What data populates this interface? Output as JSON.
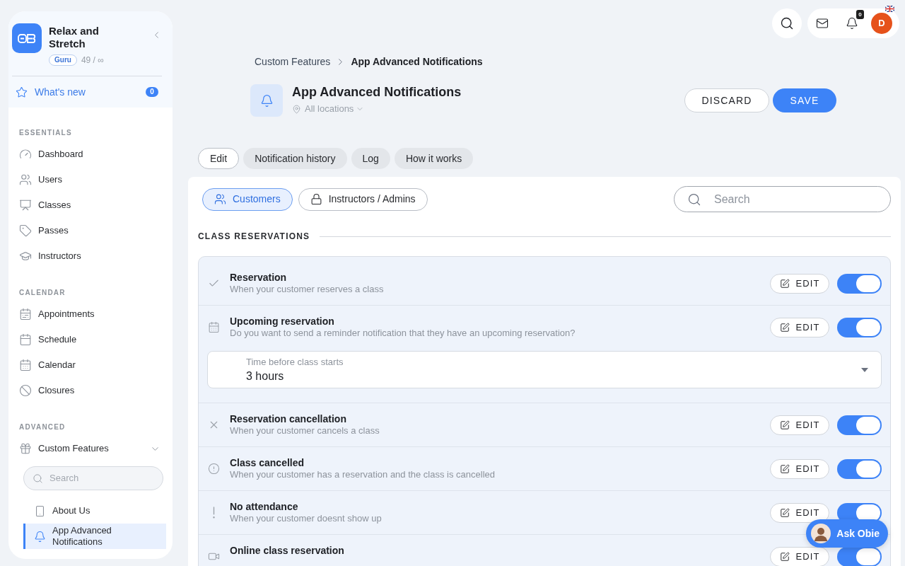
{
  "sidebar": {
    "brand": {
      "name": "Relax and Stretch",
      "plan": "Guru",
      "usage": "49 / ∞"
    },
    "whats_new": {
      "label": "What's new",
      "count": "0"
    },
    "sections": [
      {
        "title": "ESSENTIALS",
        "items": [
          {
            "label": "Dashboard",
            "selected": false
          },
          {
            "label": "Users",
            "selected": false
          },
          {
            "label": "Classes",
            "selected": false
          },
          {
            "label": "Passes",
            "selected": false
          },
          {
            "label": "Instructors",
            "selected": false
          }
        ]
      },
      {
        "title": "CALENDAR",
        "items": [
          {
            "label": "Appointments",
            "selected": false
          },
          {
            "label": "Schedule",
            "selected": false
          },
          {
            "label": "Calendar",
            "selected": false
          },
          {
            "label": "Closures",
            "selected": false
          }
        ]
      },
      {
        "title": "ADVANCED",
        "items": [
          {
            "label": "Custom Features",
            "selected": false,
            "expanded": true,
            "search": {
              "placeholder": "Search"
            },
            "children": [
              {
                "label": "About Us",
                "selected": false
              },
              {
                "label": "App Advanced Notifications",
                "selected": true
              }
            ]
          }
        ]
      }
    ]
  },
  "top_bar": {
    "notification_count": "0",
    "avatar_initial": "D"
  },
  "breadcrumb": [
    "Custom Features",
    "App Advanced Notifications"
  ],
  "header": {
    "title": "App Advanced Notifications",
    "location": "All locations"
  },
  "actions": [
    {
      "label": "DISCARD",
      "kind": "secondary"
    },
    {
      "label": "SAVE",
      "kind": "primary"
    }
  ],
  "tabs": [
    {
      "label": "Edit",
      "selected": true
    },
    {
      "label": "Notification history",
      "selected": false
    },
    {
      "label": "Log",
      "selected": false
    },
    {
      "label": "How it works",
      "selected": false
    }
  ],
  "audience": [
    {
      "label": "Customers",
      "selected": true
    },
    {
      "label": "Instructors / Admins",
      "selected": false
    }
  ],
  "search": {
    "placeholder": "Search"
  },
  "section": {
    "title": "CLASS RESERVATIONS",
    "rows": [
      {
        "title": "Reservation",
        "description": "When your customer reserves a class",
        "edit": "EDIT",
        "on": true
      },
      {
        "title": "Upcoming reservation",
        "description": "Do you want to send a reminder notification that they have an upcoming reservation?",
        "edit": "EDIT",
        "on": true,
        "setting": {
          "label": "Time before class starts",
          "value": "3 hours"
        }
      },
      {
        "title": "Reservation cancellation",
        "description": "When your customer cancels a class",
        "edit": "EDIT",
        "on": true
      },
      {
        "title": "Class cancelled",
        "description": "When your customer has a reservation and the class is cancelled",
        "edit": "EDIT",
        "on": true
      },
      {
        "title": "No attendance",
        "description": "When your customer doesnt show up",
        "edit": "EDIT",
        "on": true
      },
      {
        "title": "Online class reservation",
        "edit": "EDIT",
        "on": true
      }
    ]
  },
  "assistant": {
    "label": "Ask Obie"
  }
}
